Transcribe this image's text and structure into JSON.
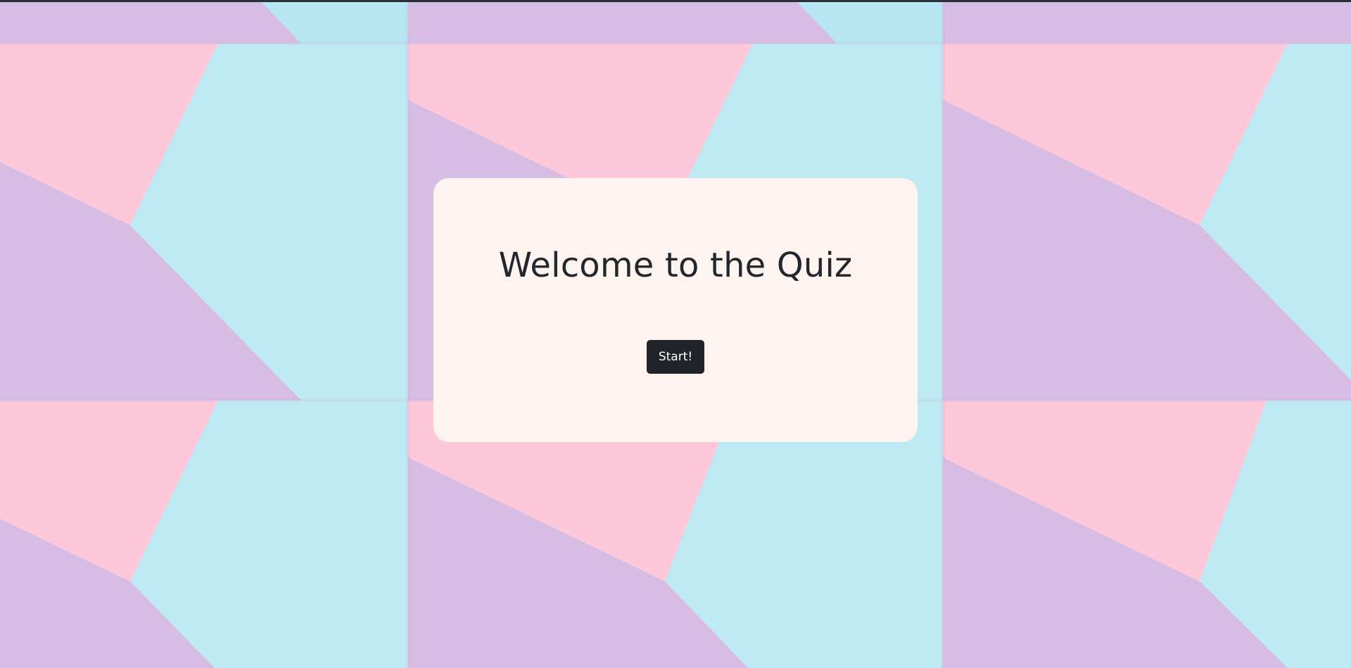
{
  "welcome": {
    "title": "Welcome to the Quiz",
    "start_label": "Start!"
  },
  "colors": {
    "background_pink": "#fdc9da",
    "background_purple": "#d7bde3",
    "background_blue": "#bfeaf3",
    "card_background": "#fdf4ef",
    "button_background": "#212529",
    "button_text": "#ffffff",
    "title_text": "#23272d"
  }
}
